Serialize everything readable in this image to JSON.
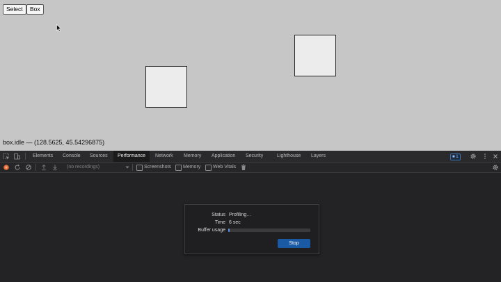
{
  "page": {
    "buttons": {
      "select": "Select",
      "box": "Box"
    },
    "status_line": "box.idle — (128.5625, 45.54296875)"
  },
  "devtools": {
    "tabs": [
      "Elements",
      "Console",
      "Sources",
      "Performance",
      "Network",
      "Memory",
      "Application",
      "Security",
      "Lighthouse",
      "Layers"
    ],
    "active_tab": "Performance",
    "issues_badge": "1",
    "toolbar": {
      "recordings_placeholder": "(no recordings)",
      "screenshots_label": "Screenshots",
      "memory_label": "Memory",
      "web_vitals_label": "Web Vitals"
    },
    "dialog": {
      "status_label": "Status",
      "status_value": "Profiling…",
      "time_label": "Time",
      "time_value": "6 sec",
      "buffer_label": "Buffer usage",
      "buffer_usage_fraction": 0.02,
      "stop_label": "Stop"
    },
    "colors": {
      "accent": "#1a5aa5",
      "background": "#232325",
      "page_background": "#c6c6c6"
    }
  }
}
